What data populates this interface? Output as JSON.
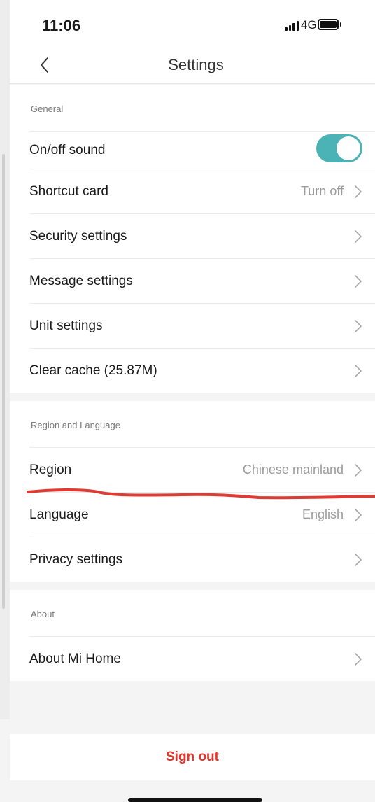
{
  "status_bar": {
    "time": "11:06",
    "network": "4G",
    "signal_bars": 4,
    "battery_level": 1.0
  },
  "nav": {
    "title": "Settings",
    "back_icon": "chevron-left-icon"
  },
  "sections": {
    "general": {
      "header": "General",
      "items": [
        {
          "label": "On/off sound",
          "toggle_on": true
        },
        {
          "label": "Shortcut card",
          "value": "Turn off"
        },
        {
          "label": "Security settings"
        },
        {
          "label": "Message settings"
        },
        {
          "label": "Unit settings"
        },
        {
          "label": "Clear cache (25.87M)"
        }
      ]
    },
    "region_language": {
      "header": "Region and Language",
      "items": [
        {
          "label": "Region",
          "value": "Chinese mainland"
        },
        {
          "label": "Language",
          "value": "English"
        },
        {
          "label": "Privacy settings"
        }
      ]
    },
    "about": {
      "header": "About",
      "items": [
        {
          "label": "About Mi Home"
        }
      ]
    }
  },
  "sign_out": {
    "label": "Sign out"
  },
  "colors": {
    "toggle": "#4bb3b5",
    "sign_out": "#e5332a",
    "annotation": "#dd3b34"
  }
}
